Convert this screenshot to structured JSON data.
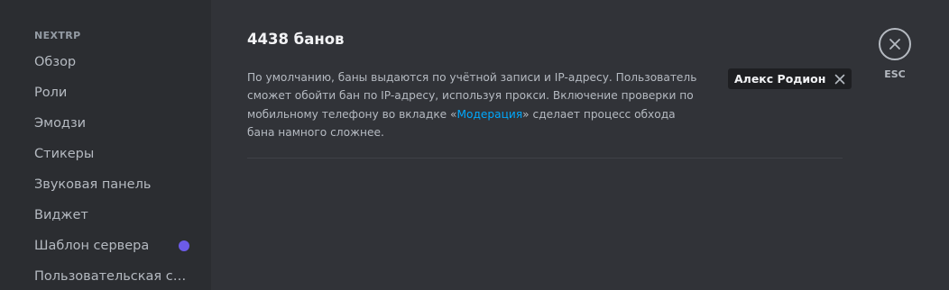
{
  "sidebar": {
    "header": "NEXTRP",
    "items": [
      {
        "label": "Обзор"
      },
      {
        "label": "Роли"
      },
      {
        "label": "Эмодзи"
      },
      {
        "label": "Стикеры"
      },
      {
        "label": "Звуковая панель"
      },
      {
        "label": "Виджет"
      },
      {
        "label": "Шаблон сервера",
        "badge_color": "#6c5be9"
      },
      {
        "label": "Пользовательская сс..."
      }
    ]
  },
  "main": {
    "title": "4438 банов",
    "description": {
      "part1": "По умолчанию, баны выдаются по учётной записи и IP-адресу. Пользователь сможет обойти бан по IP-адресу, используя прокси. Включение проверки по мобильному телефону во вкладке «",
      "link": "Модерация",
      "part2": "» сделает процесс обхода бана намного сложнее."
    },
    "filter_chip": {
      "label": "Алекс Родион",
      "icon": "close-icon"
    }
  },
  "close": {
    "icon": "close-icon",
    "label": "ESC"
  },
  "colors": {
    "background": "#313338",
    "sidebar": "#2b2d31",
    "link": "#00a8fc",
    "badge": "#6c5be9"
  }
}
